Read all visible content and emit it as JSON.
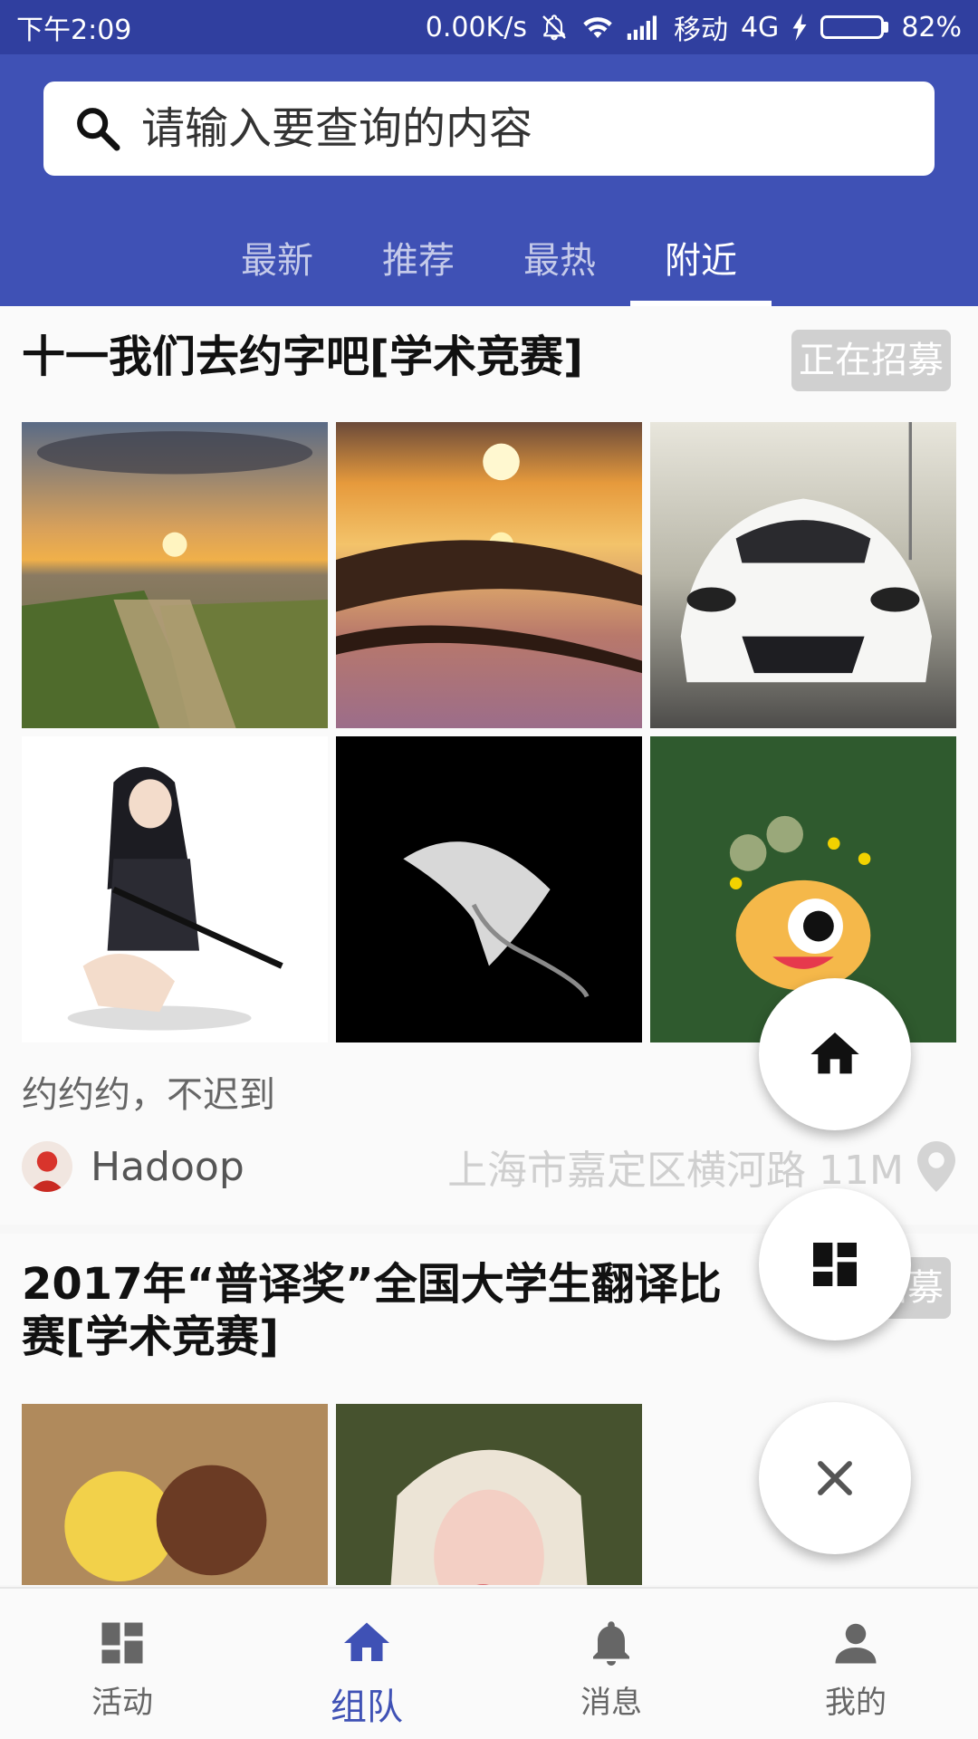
{
  "status_bar": {
    "time": "下午2:09",
    "network_speed": "0.00K/s",
    "carrier": "移动",
    "network_type": "4G",
    "battery": "82%",
    "battery_level": 0.82
  },
  "search": {
    "placeholder": "请输入要查询的内容"
  },
  "tabs": [
    {
      "label": "最新"
    },
    {
      "label": "推荐"
    },
    {
      "label": "最热"
    },
    {
      "label": "附近"
    }
  ],
  "active_tab": "附近",
  "cards": [
    {
      "title": "十一我们去约字吧[学术竞赛]",
      "status": "正在招募",
      "description": "约约约，不迟到",
      "author": "Hadoop",
      "location": "上海市嘉定区横河路 11M",
      "images": [
        "sunset-rocky-shore",
        "sunset-reflection-branch",
        "white-sports-car",
        "anime-girl-sword",
        "hooded-face-dark",
        "cartoon-dog-money"
      ]
    },
    {
      "title_line1": "2017年“普译奖”全国大学生翻译比",
      "title_line2": "赛[学术竞赛]",
      "status": "正在招募",
      "images": [
        "clay-dolls-couple",
        "blonde-girl-portrait"
      ]
    }
  ],
  "fabs": [
    "home-icon",
    "dashboard-icon",
    "close-icon"
  ],
  "bottom_nav": [
    {
      "label": "活动",
      "icon": "dashboard-icon"
    },
    {
      "label": "组队",
      "icon": "home-icon"
    },
    {
      "label": "消息",
      "icon": "bell-icon"
    },
    {
      "label": "我的",
      "icon": "person-icon"
    }
  ],
  "colors": {
    "primary": "#3f51b5",
    "status_bar": "#303f9f",
    "badge": "#d0d0d0"
  }
}
